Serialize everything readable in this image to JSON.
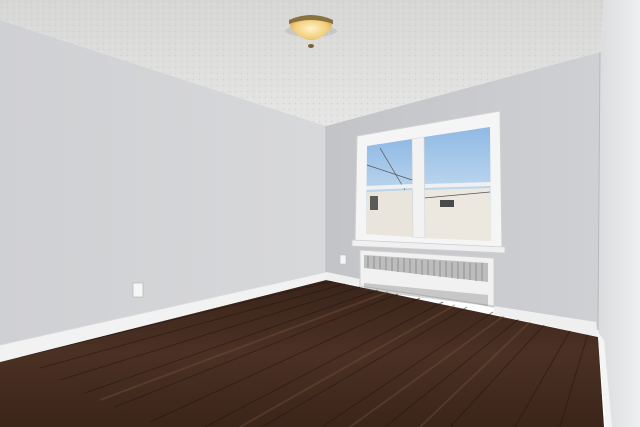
{
  "scene": {
    "description_colors": {
      "ceiling": "#d9d9d8",
      "left_wall": "#d2d3d5",
      "back_wall": "#c9cacd",
      "right_wall": "#e3e4e6",
      "baseboard": "#f2f2f2",
      "floor_dark": "#2a1a12",
      "floor_mid": "#4a3022",
      "floor_light": "#6e4c38",
      "trim": "#f4f4f4",
      "sky": "#9fc4e8",
      "light_glow": "#f7d98f"
    }
  }
}
